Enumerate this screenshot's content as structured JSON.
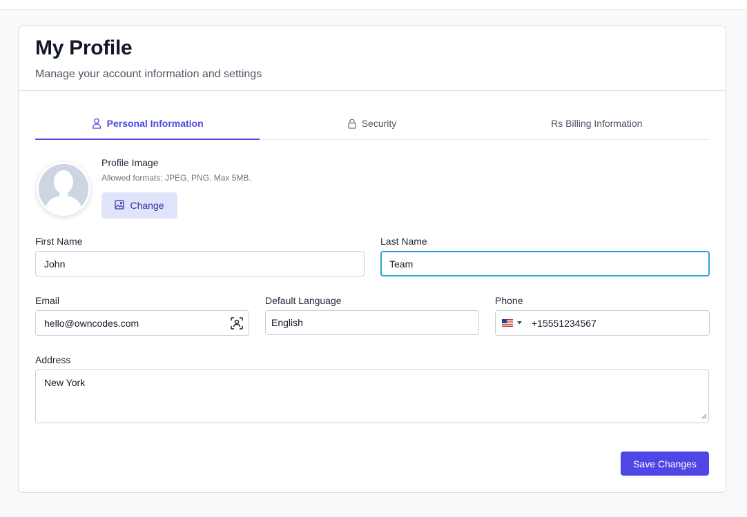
{
  "header": {
    "title": "My Profile",
    "subtitle": "Manage your account information and settings"
  },
  "tabs": [
    {
      "label": "Personal Information",
      "icon": "user-icon",
      "active": true
    },
    {
      "label": "Security",
      "icon": "lock-icon",
      "active": false
    },
    {
      "label": "Rs Billing Information",
      "icon": "",
      "active": false
    }
  ],
  "profile_image": {
    "label": "Profile Image",
    "help": "Allowed formats: JPEG, PNG. Max 5MB.",
    "change_label": "Change"
  },
  "form": {
    "first_name": {
      "label": "First Name",
      "value": "John"
    },
    "last_name": {
      "label": "Last Name",
      "value": "Team"
    },
    "email": {
      "label": "Email",
      "value": "hello@owncodes.com"
    },
    "language": {
      "label": "Default Language",
      "value": "English"
    },
    "phone": {
      "label": "Phone",
      "value": "+15551234567",
      "country": "US"
    },
    "address": {
      "label": "Address",
      "value": "New York"
    }
  },
  "actions": {
    "save_label": "Save Changes"
  },
  "colors": {
    "accent": "#4f46e5",
    "focus": "#29a3d9",
    "change_button_bg": "#e0e4fb"
  }
}
